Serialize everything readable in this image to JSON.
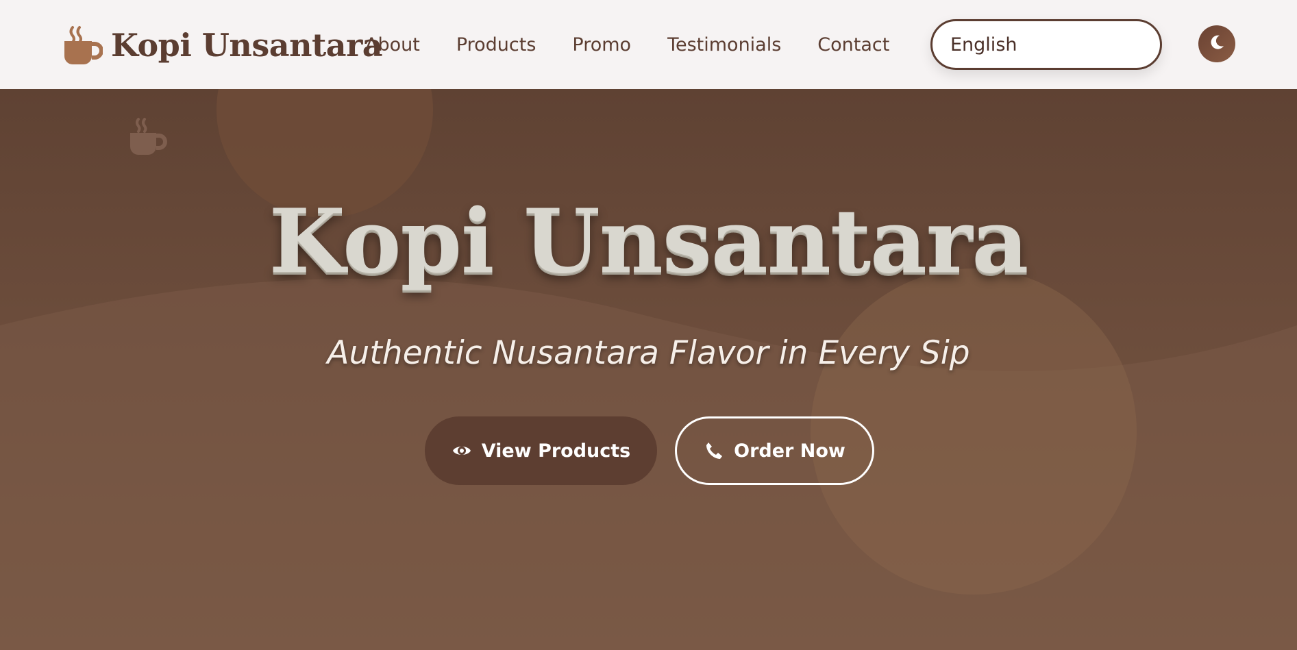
{
  "brand": {
    "name": "Kopi Unsantara",
    "icon": "coffee-cup-icon"
  },
  "nav": {
    "items": [
      {
        "label": "About"
      },
      {
        "label": "Products"
      },
      {
        "label": "Promo"
      },
      {
        "label": "Testimonials"
      },
      {
        "label": "Contact"
      }
    ]
  },
  "language": {
    "selected": "English"
  },
  "theme_toggle": {
    "icon": "moon-icon"
  },
  "hero": {
    "title": "Kopi Unsantara",
    "subtitle": "Authentic Nusantara Flavor in Every Sip",
    "decor_icon": "coffee-cup-icon",
    "buttons": {
      "view_products": {
        "label": "View Products",
        "icon": "eye-icon"
      },
      "order_now": {
        "label": "Order Now",
        "icon": "phone-icon"
      }
    }
  },
  "colors": {
    "brand_brown": "#5b3d31",
    "accent_tan": "#a8724f",
    "header_bg": "#f6f3f3",
    "hero_bg": "#6b4c3b"
  }
}
